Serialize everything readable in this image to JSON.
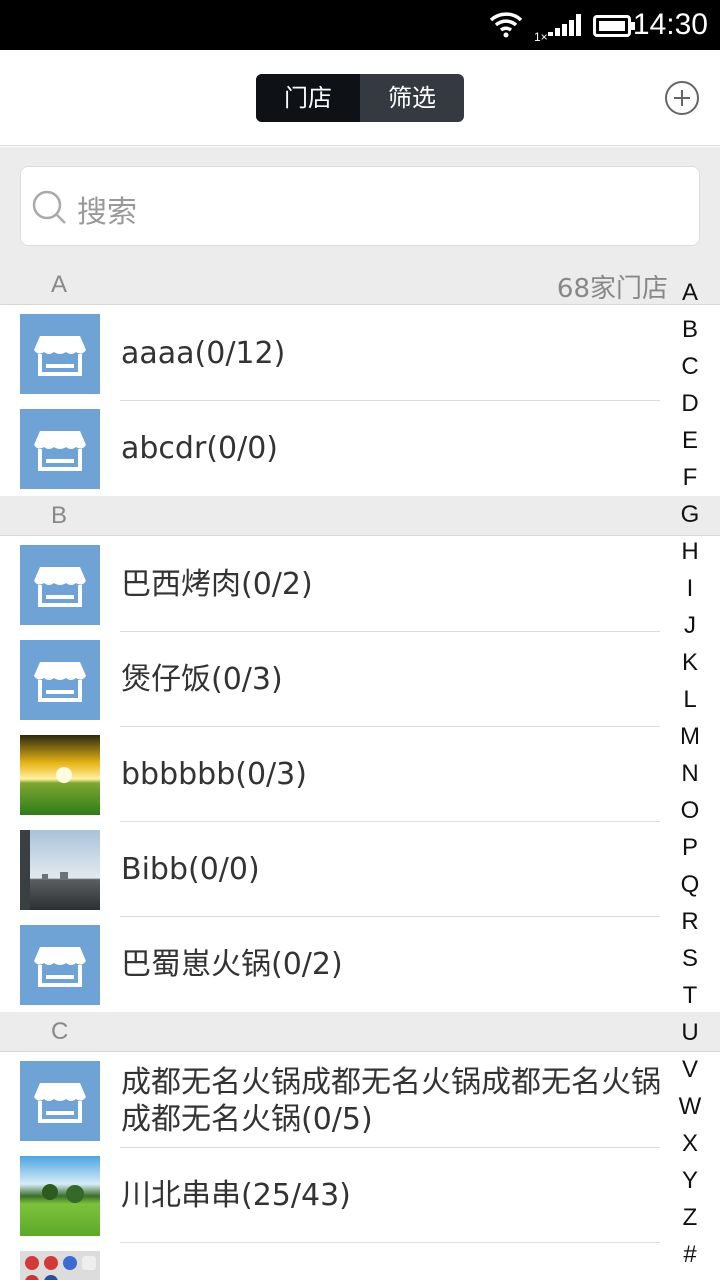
{
  "status_bar": {
    "time": "14:30",
    "network": "1×",
    "icons": [
      "wifi-icon",
      "signal-icon",
      "battery-icon"
    ]
  },
  "header": {
    "tabs": [
      {
        "label": "门店",
        "active": true
      },
      {
        "label": "筛选",
        "active": false
      }
    ],
    "add_icon": "plus-circle-icon"
  },
  "search": {
    "placeholder": "搜索",
    "icon": "search-icon"
  },
  "summary": {
    "store_count": "68家门店"
  },
  "sections": [
    {
      "letter": "A",
      "items": [
        {
          "name": "aaaa(0/12)",
          "thumb": "store-icon"
        },
        {
          "name": "abcdr(0/0)",
          "thumb": "store-icon"
        }
      ]
    },
    {
      "letter": "B",
      "items": [
        {
          "name": "巴西烤肉(0/2)",
          "thumb": "store-icon"
        },
        {
          "name": "煲仔饭(0/3)",
          "thumb": "store-icon"
        },
        {
          "name": "bbbbbb(0/3)",
          "thumb": "sunset-photo"
        },
        {
          "name": "Bibb(0/0)",
          "thumb": "sky-photo"
        },
        {
          "name": "巴蜀崽火锅(0/2)",
          "thumb": "store-icon"
        }
      ]
    },
    {
      "letter": "C",
      "items": [
        {
          "name": "成都无名火锅成都无名火锅成都无名火锅成都无名火锅(0/5)",
          "thumb": "store-icon"
        },
        {
          "name": "川北串串(25/43)",
          "thumb": "meadow-photo"
        },
        {
          "name": "",
          "thumb": "app-grid-photo"
        }
      ]
    }
  ],
  "colors": {
    "store_icon_bg": "#6fa3d6",
    "tab_active_bg": "#0e1216",
    "tab_bg": "#343a3f",
    "section_bg": "#ececec"
  },
  "index_letters": [
    "A",
    "B",
    "C",
    "D",
    "E",
    "F",
    "G",
    "H",
    "I",
    "J",
    "K",
    "L",
    "M",
    "N",
    "O",
    "P",
    "Q",
    "R",
    "S",
    "T",
    "U",
    "V",
    "W",
    "X",
    "Y",
    "Z",
    "#"
  ]
}
